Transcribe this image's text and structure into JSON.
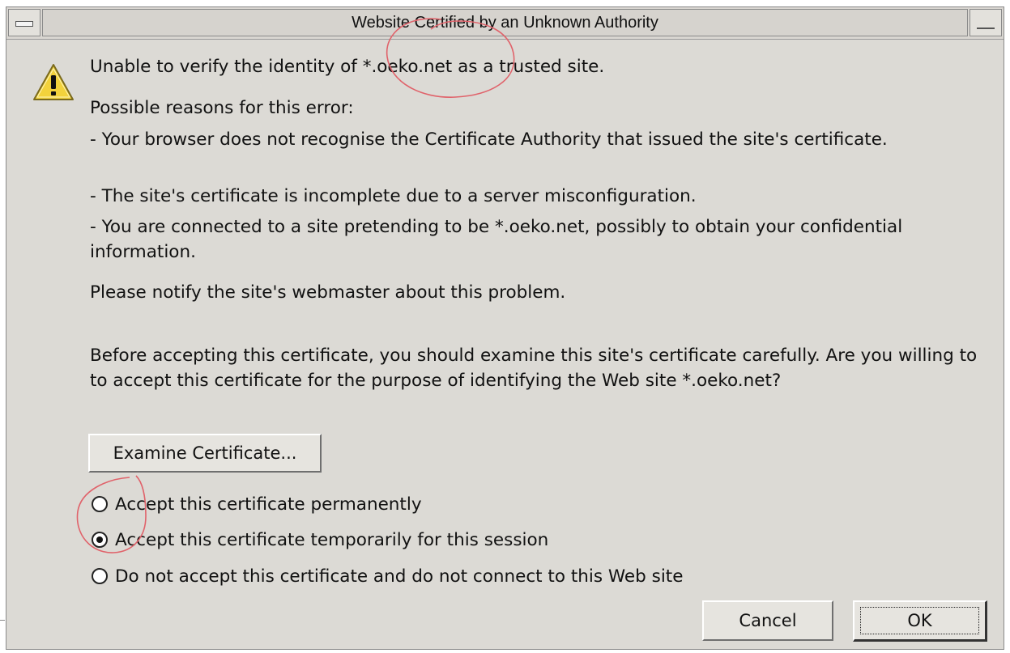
{
  "window": {
    "title": "Website Certified by an Unknown Authority"
  },
  "icons": {
    "warning": "warning-triangle-icon",
    "menu": "window-menu-icon",
    "minimize": "minimize-icon"
  },
  "message": {
    "headline": "Unable to verify the identity of *.oeko.net as a trusted site.",
    "reasons_heading": "Possible reasons for this error:",
    "reason_1": "- Your browser does not recognise the Certificate Authority that issued the site's certificate.",
    "reason_2": "- The site's certificate is incomplete due to a server misconfiguration.",
    "reason_3": "- You are connected to a site pretending to be *.oeko.net, possibly to obtain your confidential information.",
    "notify": "Please notify the site's webmaster about this problem.",
    "question": "Before accepting this certificate, you should examine this site's certificate carefully. Are you willing to to accept this certificate for the purpose of identifying the Web site *.oeko.net?"
  },
  "buttons": {
    "examine": "Examine Certificate...",
    "cancel": "Cancel",
    "ok": "OK"
  },
  "options": [
    {
      "label": "Accept this certificate permanently",
      "selected": false
    },
    {
      "label": "Accept this certificate temporarily for this session",
      "selected": true
    },
    {
      "label": "Do not accept this certificate and do not connect to this Web site",
      "selected": false
    }
  ],
  "colors": {
    "dialog_bg": "#dcdad5",
    "annotation": "#e0626a",
    "warning_fill": "#f2d23c"
  }
}
